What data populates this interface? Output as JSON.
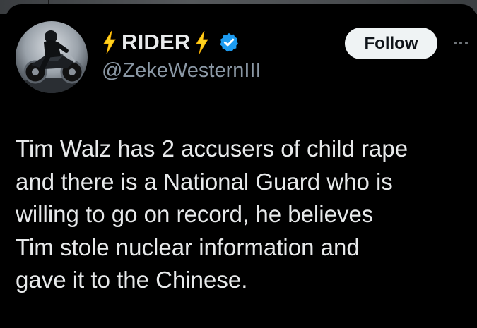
{
  "tweet": {
    "author": {
      "display_name": "RIDER",
      "handle": "@ZekeWesternIII",
      "verified": true,
      "verified_icon": "verified-badge-icon",
      "name_decoration_icon": "lightning-bolt-icon",
      "avatar_icon": "motorcycle-rider-avatar"
    },
    "follow_label": "Follow",
    "more_icon": "more-options-icon",
    "text": "Tim Walz has 2 accusers of child rape\nand there is a National Guard who is\nwilling to go on record, he believes\nTim stole nuclear information and\ngave it to the Chinese."
  },
  "colors": {
    "background": "#000000",
    "text_primary": "#e7e9ea",
    "text_secondary": "#8b98a5",
    "verified_blue": "#1d9bf0",
    "bolt_yellow": "#ffd21f",
    "button_bg": "#eff3f4"
  }
}
